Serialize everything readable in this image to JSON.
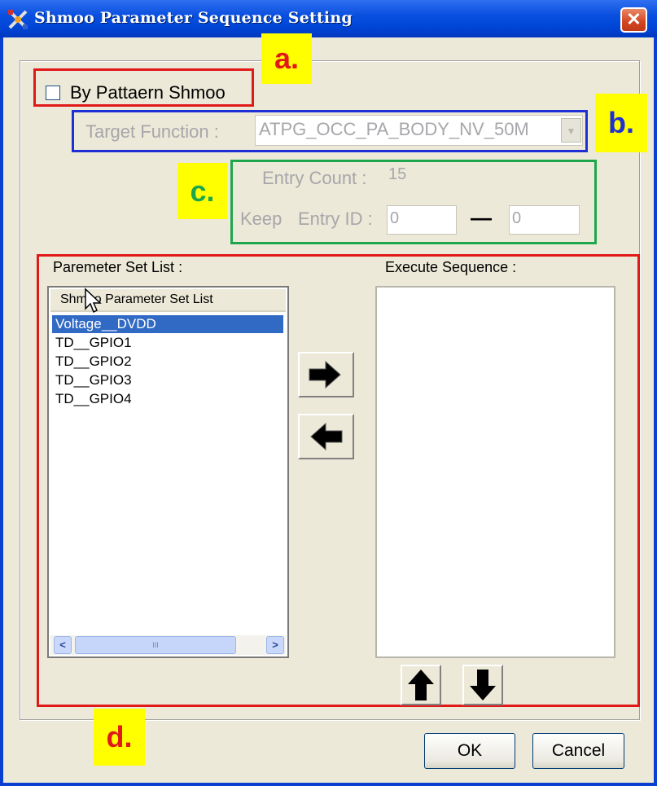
{
  "window": {
    "title": "Shmoo Parameter Sequence Setting",
    "close_glyph": "✕"
  },
  "annotations": {
    "a": "a.",
    "b": "b.",
    "c": "c.",
    "d": "d."
  },
  "annotation_colors": {
    "a": "#e11919",
    "b": "#1f2fd6",
    "c": "#1ea64c",
    "d": "#e11919"
  },
  "by_pattern": {
    "label": "By Pattaern Shmoo",
    "checked": false
  },
  "target_function": {
    "label": "Target Function :",
    "value": "ATPG_OCC_PA_BODY_NV_50M"
  },
  "entry": {
    "count_label": "Entry Count :",
    "count_value": "15",
    "keep_label": "Keep",
    "id_label": "Entry ID :",
    "id_from": "0",
    "id_to": "0",
    "dash": "—"
  },
  "parameter_set_list": {
    "label": "Paremeter Set List :",
    "column_header": "Shmoo Parameter Set List",
    "items": [
      "Voltage__DVDD",
      "TD__GPIO1",
      "TD__GPIO2",
      "TD__GPIO3",
      "TD__GPIO4"
    ],
    "selected_index": 0,
    "scroll_left": "<",
    "scroll_right": ">",
    "thumb_grip": "III"
  },
  "execute_sequence": {
    "label": "Execute Sequence :",
    "items": []
  },
  "buttons": {
    "ok": "OK",
    "cancel": "Cancel"
  },
  "icons": {
    "add": "arrow-right-icon",
    "remove": "arrow-left-icon",
    "move_up": "arrow-up-icon",
    "move_down": "arrow-down-icon"
  },
  "colors": {
    "titlebar": "#0a50e0",
    "dialog_bg": "#ece9d8",
    "selection": "#316ac5"
  }
}
